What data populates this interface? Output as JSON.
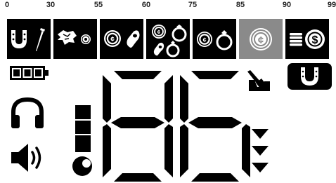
{
  "scale": {
    "labels": [
      "0",
      "30",
      "55",
      "60",
      "75",
      "85",
      "90",
      "99"
    ]
  },
  "notches": [
    {
      "icons": [
        "horseshoe-icon",
        "nail-icon"
      ],
      "highlighted": false
    },
    {
      "icons": [
        "foil-icon",
        "small-coin-icon"
      ],
      "highlighted": false
    },
    {
      "icons": [
        "coin-icon",
        "pull-tab-icon"
      ],
      "highlighted": false
    },
    {
      "icons": [
        "coin-icon",
        "ring-icon",
        "pull-tab-icon",
        "ring-icon"
      ],
      "highlighted": false
    },
    {
      "icons": [
        "coin-icon",
        "ring-icon"
      ],
      "highlighted": false
    },
    {
      "icons": [
        "coin-icon"
      ],
      "highlighted": true
    },
    {
      "icons": [
        "coin-stack-icon",
        "dollar-coin-icon"
      ],
      "highlighted": false
    }
  ],
  "target_id": {
    "value": "86"
  },
  "status": {
    "battery_level": 1.0,
    "depth_level": 3,
    "mode_icon": "horseshoe-icon",
    "dig_icon": "shovel-icon",
    "sensitivity_bars": 3
  },
  "colors": {
    "background": "#ffffff",
    "segment": "#000000",
    "highlight": "#8a8a8a"
  }
}
